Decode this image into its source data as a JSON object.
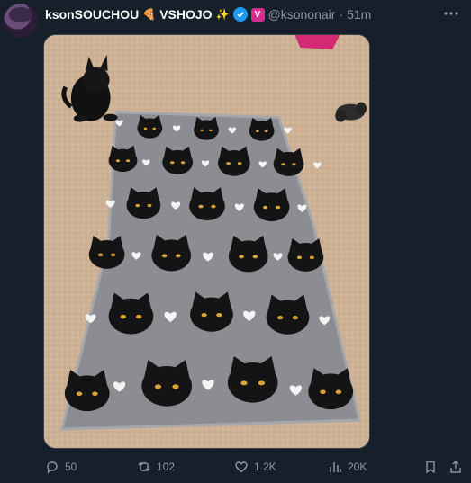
{
  "author": {
    "display_name": "ksonSOUCHOU",
    "name_emojis": [
      "🍕",
      "VSHOJO",
      "✨"
    ],
    "handle": "@ksononair",
    "separator": "·",
    "time": "51m",
    "affiliation_badge": "V"
  },
  "icons": {
    "verified": "verified-check-icon",
    "more": "more-horizontal-icon",
    "reply": "reply-icon",
    "retweet": "retweet-icon",
    "like": "heart-icon",
    "views": "views-icon",
    "bookmark": "bookmark-icon",
    "share": "share-icon"
  },
  "actions": {
    "replies": "50",
    "retweets": "102",
    "likes": "1.2K",
    "views": "20K"
  },
  "colors": {
    "background": "#15202b",
    "muted_text": "#8b98a5",
    "verified": "#1d9bf0",
    "affiliation": "#d62c8c"
  }
}
